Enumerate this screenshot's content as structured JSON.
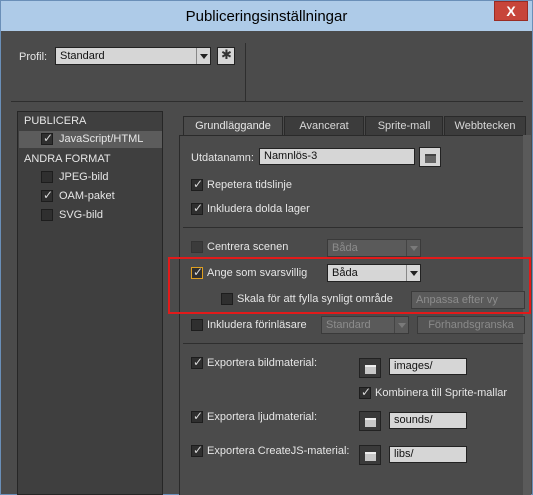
{
  "window": {
    "title": "Publiceringsinställningar",
    "close_label": "X"
  },
  "profile": {
    "label": "Profil:",
    "value": "Standard"
  },
  "left_panel": {
    "publish_header": "PUBLICERA",
    "publish_items": [
      {
        "label": "JavaScript/HTML",
        "checked": true
      }
    ],
    "other_header": "ANDRA FORMAT",
    "other_items": [
      {
        "label": "JPEG-bild",
        "checked": false
      },
      {
        "label": "OAM-paket",
        "checked": true
      },
      {
        "label": "SVG-bild",
        "checked": false
      }
    ]
  },
  "tabs": [
    "Grundläggande",
    "Avancerat",
    "Sprite-mall",
    "Webbtecken"
  ],
  "basic": {
    "output_label": "Utdatanamn:",
    "output_value": "Namnlös-3",
    "loop_label": "Repetera tidslinje",
    "hidden_layers_label": "Inkludera dolda lager",
    "center_label": "Centrera scenen",
    "center_value": "Båda",
    "responsive_label": "Ange som svarsvillig",
    "responsive_value": "Båda",
    "scale_label": "Skala för att fylla synligt område",
    "scale_value": "Anpassa efter vy",
    "preloader_label": "Inkludera förinläsare",
    "preloader_value": "Standard",
    "preview_button": "Förhandsgranska",
    "export_images_label": "Exportera bildmaterial:",
    "images_path": "images/",
    "combine_sprites_label": "Kombinera till Sprite-mallar",
    "export_sounds_label": "Exportera ljudmaterial:",
    "sounds_path": "sounds/",
    "export_createjs_label": "Exportera CreateJS-material:",
    "libs_path": "libs/"
  },
  "colors": {
    "highlight": "#e21a1a",
    "title_bar": "#aecbe8"
  }
}
